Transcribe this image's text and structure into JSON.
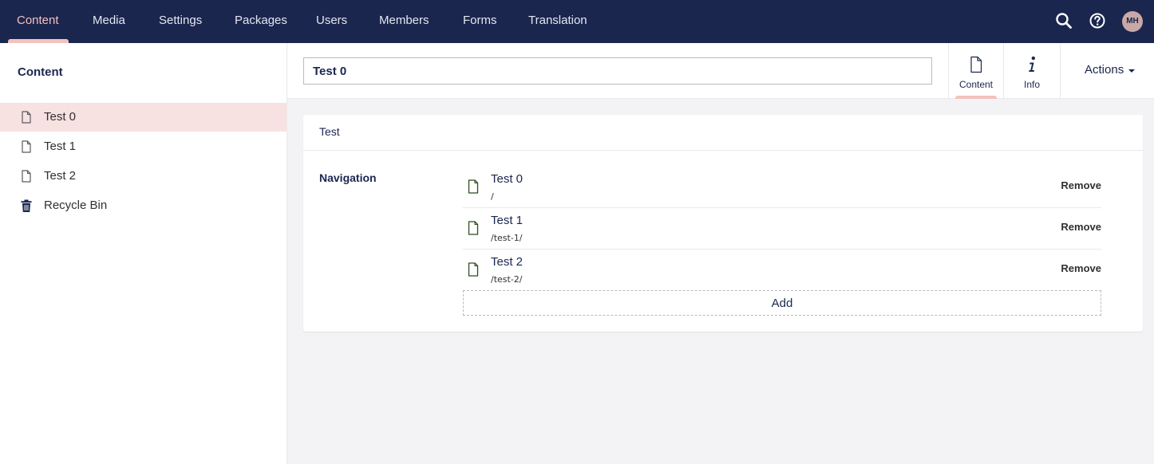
{
  "topnav": {
    "items": [
      {
        "label": "Content",
        "active": true
      },
      {
        "label": "Media"
      },
      {
        "label": "Settings"
      },
      {
        "label": "Packages"
      },
      {
        "label": "Users"
      },
      {
        "label": "Members"
      },
      {
        "label": "Forms"
      },
      {
        "label": "Translation"
      }
    ],
    "icons": [
      "search-icon",
      "help-icon"
    ],
    "avatar_initials": "MH"
  },
  "sidebar": {
    "title": "Content",
    "items": [
      {
        "label": "Test 0",
        "icon": "document-icon",
        "selected": true
      },
      {
        "label": "Test 1",
        "icon": "document-icon"
      },
      {
        "label": "Test 2",
        "icon": "document-icon"
      },
      {
        "label": "Recycle Bin",
        "icon": "trash-icon"
      }
    ]
  },
  "header": {
    "name_value": "Test 0",
    "tabs": [
      {
        "label": "Content",
        "icon": "document-icon",
        "active": true
      },
      {
        "label": "Info",
        "icon": "info-icon"
      }
    ],
    "actions_label": "Actions"
  },
  "card": {
    "title": "Test",
    "property_label": "Navigation",
    "items": [
      {
        "name": "Test 0",
        "url": "/",
        "remove_label": "Remove"
      },
      {
        "name": "Test 1",
        "url": "/test-1/",
        "remove_label": "Remove"
      },
      {
        "name": "Test 2",
        "url": "/test-2/",
        "remove_label": "Remove"
      }
    ],
    "add_label": "Add"
  },
  "colors": {
    "topbar": "#1b264f",
    "accent": "#f5c1bc",
    "selected_row": "#f7e2e1"
  }
}
